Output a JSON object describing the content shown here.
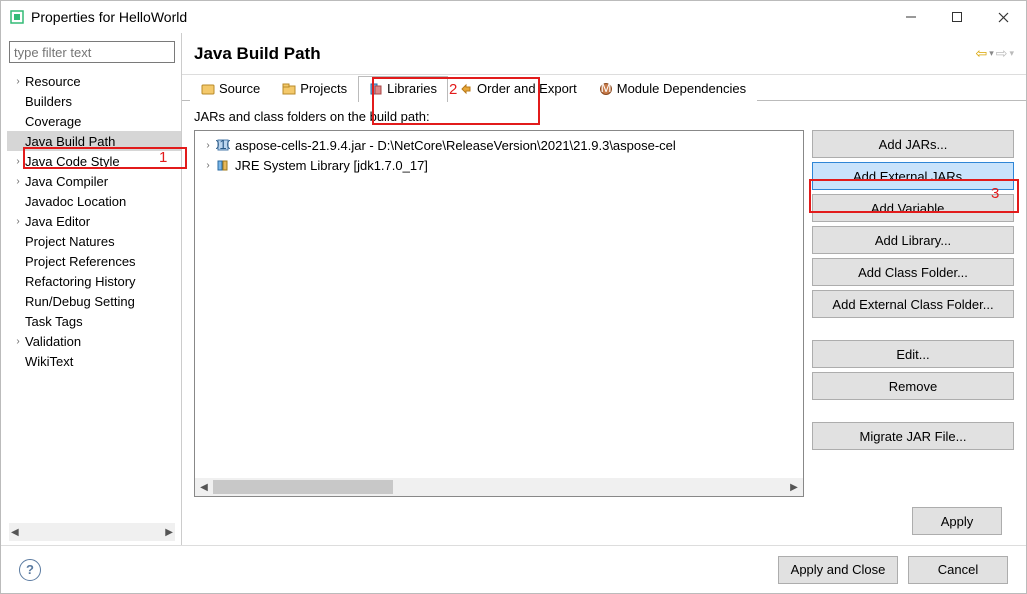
{
  "window": {
    "title": "Properties for HelloWorld"
  },
  "sidebar": {
    "filter_placeholder": "type filter text",
    "items": [
      {
        "label": "Resource",
        "expandable": true
      },
      {
        "label": "Builders",
        "expandable": false
      },
      {
        "label": "Coverage",
        "expandable": false
      },
      {
        "label": "Java Build Path",
        "expandable": false,
        "selected": true
      },
      {
        "label": "Java Code Style",
        "expandable": true
      },
      {
        "label": "Java Compiler",
        "expandable": true
      },
      {
        "label": "Javadoc Location",
        "expandable": false
      },
      {
        "label": "Java Editor",
        "expandable": true
      },
      {
        "label": "Project Natures",
        "expandable": false
      },
      {
        "label": "Project References",
        "expandable": false
      },
      {
        "label": "Refactoring History",
        "expandable": false
      },
      {
        "label": "Run/Debug Setting",
        "expandable": false
      },
      {
        "label": "Task Tags",
        "expandable": false
      },
      {
        "label": "Validation",
        "expandable": true
      },
      {
        "label": "WikiText",
        "expandable": false
      }
    ]
  },
  "main": {
    "heading": "Java Build Path",
    "tabs": [
      {
        "label": "Source"
      },
      {
        "label": "Projects"
      },
      {
        "label": "Libraries",
        "active": true
      },
      {
        "label": "Order and Export"
      },
      {
        "label": "Module Dependencies"
      }
    ],
    "desc": "JARs and class folders on the build path:",
    "entries": [
      {
        "label": "aspose-cells-21.9.4.jar - D:\\NetCore\\ReleaseVersion\\2021\\21.9.3\\aspose-cel",
        "icon": "jar"
      },
      {
        "label": "JRE System Library [jdk1.7.0_17]",
        "icon": "lib"
      }
    ],
    "buttons": {
      "add_jars": "Add JARs...",
      "add_ext_jars": "Add External JARs...",
      "add_variable": "Add Variable...",
      "add_library": "Add Library...",
      "add_class_folder": "Add Class Folder...",
      "add_ext_class_folder": "Add External Class Folder...",
      "edit": "Edit...",
      "remove": "Remove",
      "migrate": "Migrate JAR File..."
    },
    "apply": "Apply"
  },
  "footer": {
    "apply_close": "Apply and Close",
    "cancel": "Cancel"
  },
  "annotations": {
    "a1": "1",
    "a2": "2",
    "a3": "3"
  }
}
